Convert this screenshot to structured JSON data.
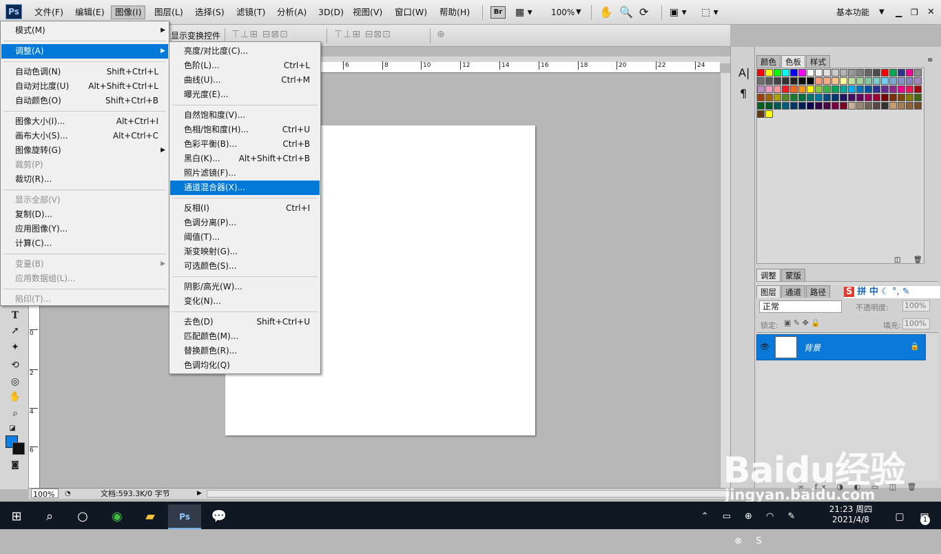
{
  "menubar": {
    "logo": "Ps",
    "items": [
      "文件(F)",
      "编辑(E)",
      "图像(I)",
      "图层(L)",
      "选择(S)",
      "滤镜(T)",
      "分析(A)",
      "3D(D)",
      "视图(V)",
      "窗口(W)",
      "帮助(H)"
    ],
    "br_label": "Br",
    "zoom": "100%",
    "workspace": "基本功能"
  },
  "optbar": {
    "show_transform": "显示变换控件"
  },
  "image_menu": {
    "items": [
      {
        "label": "模式(M)",
        "shortcut": "",
        "submenu": true,
        "disabled": false
      },
      {
        "label": "调整(A)",
        "shortcut": "",
        "submenu": true,
        "disabled": false,
        "highlight": true
      },
      {
        "label": "自动色调(N)",
        "shortcut": "Shift+Ctrl+L"
      },
      {
        "label": "自动对比度(U)",
        "shortcut": "Alt+Shift+Ctrl+L"
      },
      {
        "label": "自动颜色(O)",
        "shortcut": "Shift+Ctrl+B"
      },
      {
        "label": "图像大小(I)...",
        "shortcut": "Alt+Ctrl+I"
      },
      {
        "label": "画布大小(S)...",
        "shortcut": "Alt+Ctrl+C"
      },
      {
        "label": "图像旋转(G)",
        "shortcut": "",
        "submenu": true
      },
      {
        "label": "裁剪(P)",
        "shortcut": "",
        "disabled": true
      },
      {
        "label": "裁切(R)...",
        "shortcut": ""
      },
      {
        "label": "显示全部(V)",
        "shortcut": "",
        "disabled": true
      },
      {
        "label": "复制(D)...",
        "shortcut": ""
      },
      {
        "label": "应用图像(Y)...",
        "shortcut": ""
      },
      {
        "label": "计算(C)...",
        "shortcut": ""
      },
      {
        "label": "变量(B)",
        "shortcut": "",
        "submenu": true,
        "disabled": true
      },
      {
        "label": "应用数据组(L)...",
        "shortcut": "",
        "disabled": true
      },
      {
        "label": "陷印(T)...",
        "shortcut": "",
        "disabled": true
      }
    ]
  },
  "adjust_menu": {
    "items": [
      {
        "label": "亮度/对比度(C)...",
        "shortcut": ""
      },
      {
        "label": "色阶(L)...",
        "shortcut": "Ctrl+L"
      },
      {
        "label": "曲线(U)...",
        "shortcut": "Ctrl+M"
      },
      {
        "label": "曝光度(E)...",
        "shortcut": ""
      },
      {
        "label": "自然饱和度(V)...",
        "shortcut": ""
      },
      {
        "label": "色相/饱和度(H)...",
        "shortcut": "Ctrl+U"
      },
      {
        "label": "色彩平衡(B)...",
        "shortcut": "Ctrl+B"
      },
      {
        "label": "黑白(K)...",
        "shortcut": "Alt+Shift+Ctrl+B"
      },
      {
        "label": "照片滤镜(F)...",
        "shortcut": ""
      },
      {
        "label": "通道混合器(X)...",
        "shortcut": "",
        "highlight": true
      },
      {
        "label": "反相(I)",
        "shortcut": "Ctrl+I"
      },
      {
        "label": "色调分离(P)...",
        "shortcut": ""
      },
      {
        "label": "阈值(T)...",
        "shortcut": ""
      },
      {
        "label": "渐变映射(G)...",
        "shortcut": ""
      },
      {
        "label": "可选颜色(S)...",
        "shortcut": ""
      },
      {
        "label": "阴影/高光(W)...",
        "shortcut": ""
      },
      {
        "label": "变化(N)...",
        "shortcut": ""
      },
      {
        "label": "去色(D)",
        "shortcut": "Shift+Ctrl+U"
      },
      {
        "label": "匹配颜色(M)...",
        "shortcut": ""
      },
      {
        "label": "替换颜色(R)...",
        "shortcut": ""
      },
      {
        "label": "色调均化(Q)",
        "shortcut": ""
      }
    ]
  },
  "ruler_top": [
    "6",
    "8",
    "10",
    "12",
    "14",
    "16",
    "18",
    "20",
    "22",
    "24"
  ],
  "ruler_left": [
    "0",
    "2",
    "4",
    "6"
  ],
  "status": {
    "zoom": "100%",
    "doc": "文档:593.3K/0 字节"
  },
  "panels": {
    "tabs_top": [
      "颜色",
      "色板",
      "样式"
    ],
    "tabs_mid": [
      "调整",
      "蒙版"
    ],
    "tabs_layers": [
      "图层",
      "通道",
      "路径"
    ],
    "blend_mode": "正常",
    "opacity_label": "不透明度:",
    "opacity": "100%",
    "lock_label": "锁定:",
    "fill_label": "填充:",
    "fill": "100%",
    "layer_name": "背景",
    "ime": "拼 中"
  },
  "colors": {
    "accent": "#0078d7",
    "swatches": [
      "#ff0000",
      "#ffff00",
      "#00ff00",
      "#00ffff",
      "#0000ff",
      "#ff00ff",
      "#ffffff",
      "#f2f2f2",
      "#e0e0e0",
      "#cccccc",
      "#b3b3b3",
      "#999999",
      "#808080",
      "#666666",
      "#4d4d4d",
      "#ff0000",
      "#00a651",
      "#2e3192",
      "#ec008c",
      "#8c8c8c",
      "#6e6e6e",
      "#595959",
      "#444444",
      "#333333",
      "#222222",
      "#111111",
      "#000000",
      "#f7977a",
      "#f9ad81",
      "#fdc68a",
      "#fff79a",
      "#c4df9b",
      "#a3d39c",
      "#82ca9d",
      "#7bcdc8",
      "#6ecff6",
      "#7ea7d8",
      "#8493ca",
      "#8882be",
      "#a187be",
      "#bc8dbf",
      "#f49ac2",
      "#f6989d",
      "#ed1c24",
      "#f26522",
      "#f7941d",
      "#fff200",
      "#8dc63f",
      "#39b54a",
      "#00a651",
      "#00a99d",
      "#00aeef",
      "#0072bc",
      "#0054a6",
      "#2e3192",
      "#662d91",
      "#92278f",
      "#ec008c",
      "#ed145b",
      "#9e0b0f",
      "#a0410d",
      "#a3620a",
      "#aba000",
      "#598527",
      "#197b30",
      "#007236",
      "#00746b",
      "#0076a3",
      "#004a80",
      "#003471",
      "#1b1464",
      "#440e62",
      "#630460",
      "#9e005d",
      "#9e0039",
      "#790000",
      "#7b2e00",
      "#7d4900",
      "#827b00",
      "#406618",
      "#005e20",
      "#005826",
      "#005952",
      "#005b7f",
      "#003663",
      "#002157",
      "#0d004c",
      "#32004b",
      "#4b0049",
      "#7b0046",
      "#7a0026",
      "#c7b299",
      "#998675",
      "#736357",
      "#534741",
      "#37302d",
      "#c69c6d",
      "#a67c52",
      "#8c6239",
      "#754c24",
      "#603913",
      "#ffff00"
    ]
  },
  "taskbar": {
    "time": "21:23 周四",
    "date": "2021/4/8",
    "notify_count": "1"
  },
  "watermark": {
    "brand": "Baidu经验",
    "url": "jingyan.baidu.com"
  }
}
